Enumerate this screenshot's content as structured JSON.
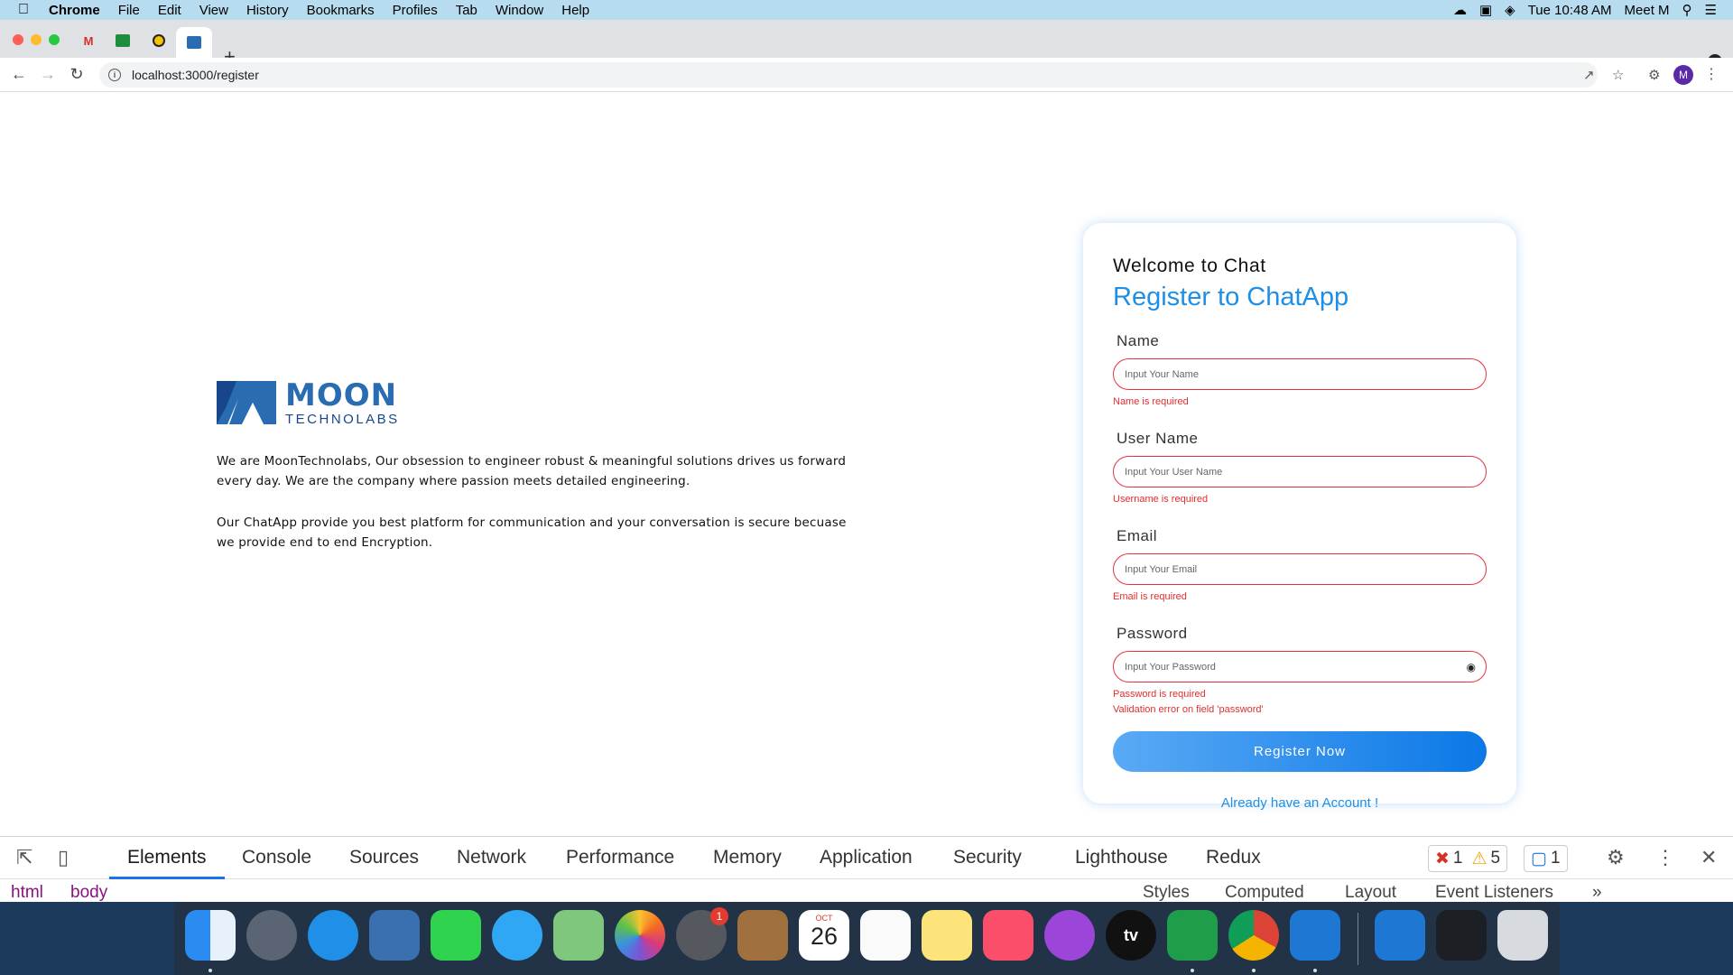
{
  "menubar": {
    "app": "Chrome",
    "items": [
      "File",
      "Edit",
      "View",
      "History",
      "Bookmarks",
      "Profiles",
      "Tab",
      "Window",
      "Help"
    ],
    "clock": "Tue 10:48 AM",
    "user": "Meet M"
  },
  "browser": {
    "url": "localhost:3000/register",
    "new_tab": "+",
    "profile_initial": "M"
  },
  "intro": {
    "logo_word1": "MOON",
    "logo_word2": "TECHNOLABS",
    "para1": "We are MoonTechnolabs, Our obsession to engineer robust & meaningful solutions drives us forward every day. We are the company where passion meets detailed engineering.",
    "para2": "Our ChatApp provide you best platform for communication and your conversation is secure becuase we provide end to end Encryption."
  },
  "form": {
    "welcome": "Welcome to Chat",
    "title": "Register to ChatApp",
    "fields": [
      {
        "label": "Name",
        "placeholder": "Input Your Name",
        "error": "Name is required"
      },
      {
        "label": "User Name",
        "placeholder": "Input Your User Name",
        "error": "Username is required"
      },
      {
        "label": "Email",
        "placeholder": "Input Your Email",
        "error": "Email is required"
      },
      {
        "label": "Password",
        "placeholder": "Input Your Password",
        "error": "Password is required",
        "error2": "Validation error on field 'password'"
      }
    ],
    "submit": "Register Now",
    "login_link": "Already have an Account !"
  },
  "devtools": {
    "tabs": [
      "Elements",
      "Console",
      "Sources",
      "Network",
      "Performance",
      "Memory",
      "Application",
      "Security",
      "Lighthouse",
      "Redux"
    ],
    "active_tab": "Elements",
    "errors": "1",
    "warnings": "5",
    "messages": "1",
    "breadcrumbs": [
      "html",
      "body"
    ],
    "side_tabs": [
      "Styles",
      "Computed",
      "Layout",
      "Event Listeners",
      "»"
    ]
  },
  "dock": {
    "calendar_month": "OCT",
    "calendar_day": "26",
    "settings_badge": "1",
    "tv_label": "tv"
  },
  "colors": {
    "accent": "#1e8fe6",
    "error": "#e12e2e",
    "brand": "#2a6cb1"
  }
}
